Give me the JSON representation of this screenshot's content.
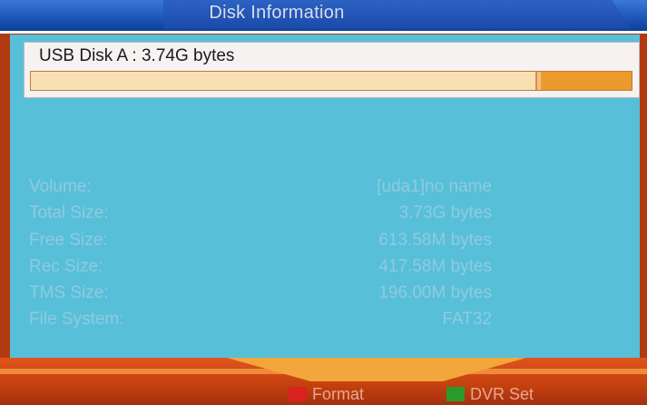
{
  "header": {
    "title": "Disk Information"
  },
  "disk": {
    "label": "USB Disk A : 3.74G bytes",
    "usage_fraction": 0.84
  },
  "info": [
    {
      "label": "Volume:",
      "value": "[uda1]no name"
    },
    {
      "label": "Total Size:",
      "value": "3.73G bytes"
    },
    {
      "label": "Free Size:",
      "value": "613.58M bytes"
    },
    {
      "label": "Rec Size:",
      "value": "417.58M bytes"
    },
    {
      "label": "TMS Size:",
      "value": "196.00M bytes"
    },
    {
      "label": "File System:",
      "value": "FAT32"
    }
  ],
  "footer": {
    "buttons": [
      {
        "label": "Format",
        "color": "#d8231e"
      },
      {
        "label": "DVR Set",
        "color": "#2a9a2a"
      }
    ]
  },
  "colors": {
    "panel": "#58bfd9",
    "header": "#1b55b8",
    "bottom": "#c6420f"
  }
}
